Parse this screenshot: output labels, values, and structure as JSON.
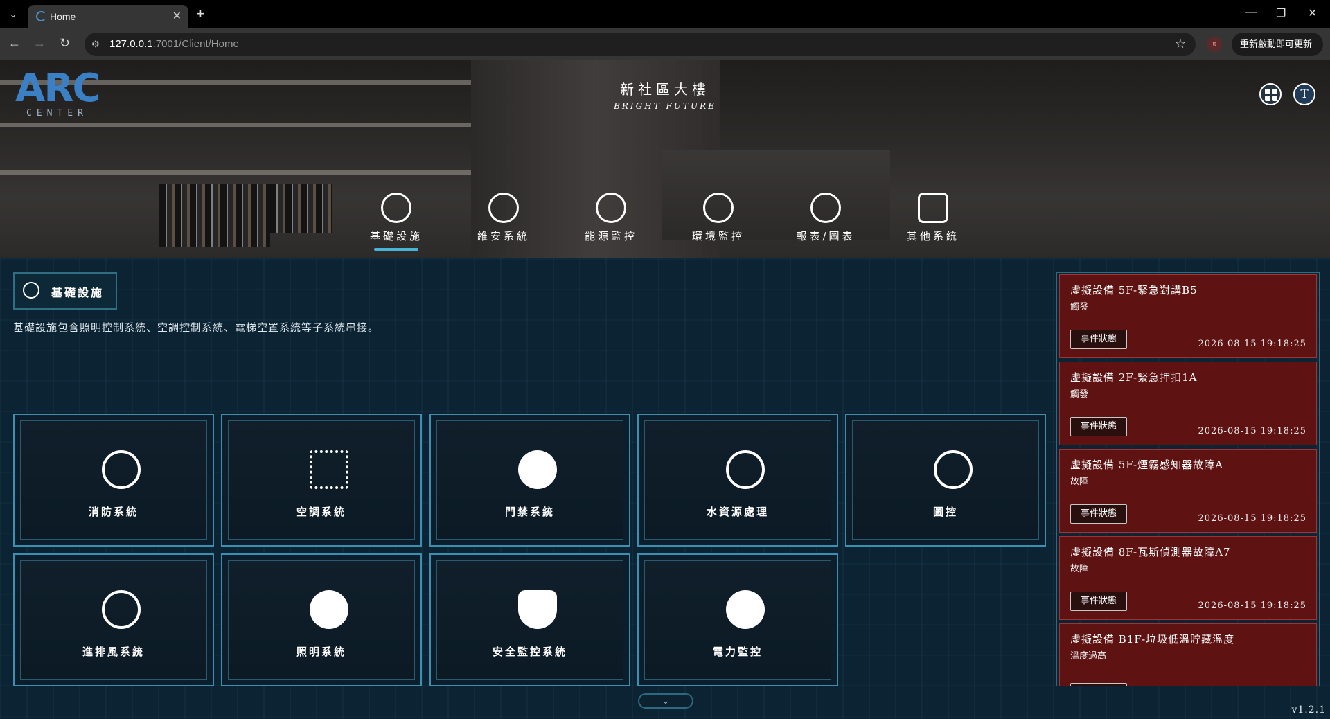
{
  "browser": {
    "tab_title": "Home",
    "url_host": "127.0.0.1",
    "url_rest": ":7001/Client/Home",
    "update_label": "重新啟動即可更新"
  },
  "header": {
    "logo_main": "ARC",
    "logo_sub": "CENTER",
    "building_name": "新社區大樓",
    "building_subtitle": "BRIGHT FUTURE",
    "user_initial": "T",
    "menu": [
      {
        "label": "基礎設施",
        "icon": "building-network-icon",
        "active": true
      },
      {
        "label": "維安系統",
        "icon": "shield-icon",
        "active": false
      },
      {
        "label": "能源監控",
        "icon": "leaf-plug-icon",
        "active": false
      },
      {
        "label": "環境監控",
        "icon": "earth-leaf-icon",
        "active": false
      },
      {
        "label": "報表/圖表",
        "icon": "pie-chart-icon",
        "active": false
      },
      {
        "label": "其他系統",
        "icon": "robot-icon",
        "active": false
      }
    ]
  },
  "section": {
    "title": "基礎設施",
    "description": "基礎設施包含照明控制系統、空調控制系統、電梯空置系統等子系統串接。"
  },
  "cards": [
    {
      "label": "消防系統",
      "icon": "fire-icon"
    },
    {
      "label": "空調系統",
      "icon": "snowflake-icon"
    },
    {
      "label": "門禁系統",
      "icon": "keyhole-icon"
    },
    {
      "label": "水資源處理",
      "icon": "water-recycle-icon"
    },
    {
      "label": "圖控",
      "icon": "building-icon"
    },
    {
      "label": "進排風系統",
      "icon": "fan-icon"
    },
    {
      "label": "照明系統",
      "icon": "lightbulb-icon"
    },
    {
      "label": "安全監控系統",
      "icon": "shield-icon"
    },
    {
      "label": "電力監控",
      "icon": "lightning-icon"
    }
  ],
  "alarms": [
    {
      "title": "虛擬設備 5F-緊急對講B5",
      "status": "觸發",
      "button": "事件狀態",
      "time": "2026-08-15 19:18:25"
    },
    {
      "title": "虛擬設備 2F-緊急押扣1A",
      "status": "觸發",
      "button": "事件狀態",
      "time": "2026-08-15 19:18:25"
    },
    {
      "title": "虛擬設備 5F-煙霧感知器故障A",
      "status": "故障",
      "button": "事件狀態",
      "time": "2026-08-15 19:18:25"
    },
    {
      "title": "虛擬設備 8F-瓦斯偵測器故障A7",
      "status": "故障",
      "button": "事件狀態",
      "time": "2026-08-15 19:18:25"
    },
    {
      "title": "虛擬設備 B1F-垃圾低溫貯藏溫度",
      "status": "溫度過高",
      "button": "",
      "time": ""
    }
  ],
  "version": "v1.2.1",
  "colors": {
    "accent": "#3b8fb0",
    "alarm_bg": "#5e1212",
    "active_bar": "#4ab3d8"
  }
}
